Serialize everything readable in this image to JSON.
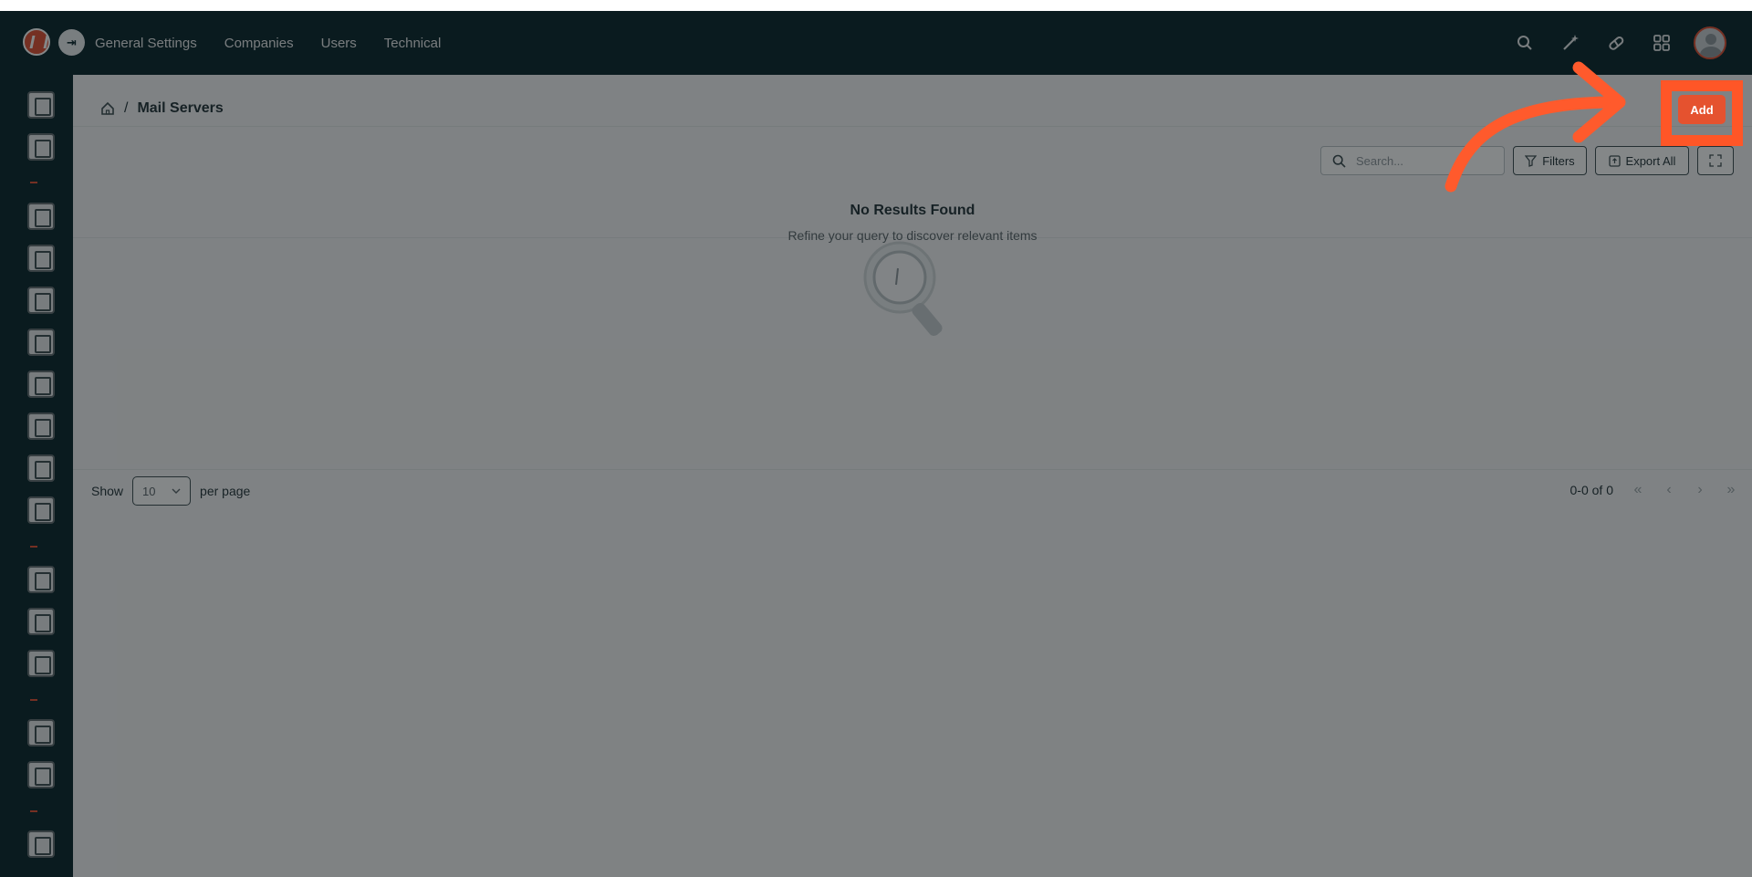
{
  "topbar": {
    "nav": [
      "General Settings",
      "Companies",
      "Users",
      "Technical"
    ],
    "icons": [
      "search-icon",
      "magic-wand-icon",
      "pill-icon",
      "apps-grid-icon"
    ]
  },
  "sidebar": {
    "icons": [
      "dashboard-icon",
      "reports-icon",
      "people-icon",
      "analytics-icon",
      "documents-icon",
      "clipboard-icon",
      "package-icon",
      "payment-icon",
      "user-search-icon",
      "calendar-icon",
      "support-icon",
      "folder-icon",
      "monitor-icon",
      "settings-icon",
      "profile-card-icon",
      "logout-icon"
    ]
  },
  "breadcrumb": {
    "separator": "/",
    "title": "Mail Servers"
  },
  "actions": {
    "add_label": "Add"
  },
  "toolbar": {
    "search_placeholder": "Search...",
    "filters_label": "Filters",
    "export_label": "Export All"
  },
  "empty_state": {
    "title": "No Results Found",
    "subtitle": "Refine your query to discover relevant items"
  },
  "pagination": {
    "show_label": "Show",
    "per_page_value": "10",
    "per_page_label": "per page",
    "range": "0-0 of 0"
  },
  "colors": {
    "brand": "#e5522f",
    "nav_bg": "#021e25",
    "highlight": "#ff5627"
  }
}
